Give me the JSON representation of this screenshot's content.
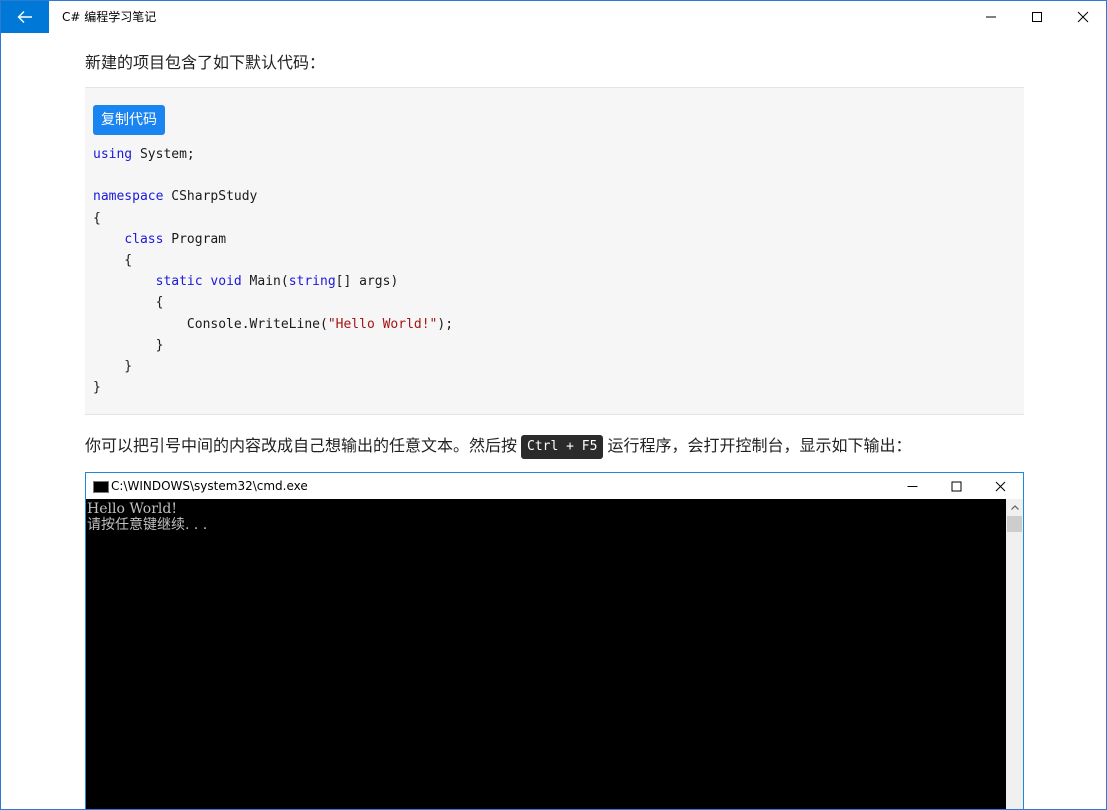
{
  "app": {
    "title": "C# 编程学习笔记"
  },
  "article": {
    "intro": "新建的项目包含了如下默认代码：",
    "copy_button": "复制代码",
    "code": {
      "l1_kw": "using",
      "l1_rest": " System;",
      "l3_kw": "namespace",
      "l3_rest": " CSharpStudy",
      "l4": "{",
      "l5_indent": "    ",
      "l5_kw": "class",
      "l5_rest": " Program",
      "l6": "    {",
      "l7_indent": "        ",
      "l7_kw1": "static",
      "l7_kw2": "void",
      "l7_mid": " Main(",
      "l7_kw3": "string",
      "l7_rest": "[] args)",
      "l8": "        {",
      "l9_pre": "            Console.WriteLine(",
      "l9_str": "\"Hello World!\"",
      "l9_post": ");",
      "l10": "        }",
      "l11": "    }",
      "l12": "}"
    },
    "para_before": "你可以把引号中间的内容改成自己想输出的任意文本。然后按",
    "shortcut": "Ctrl + F5",
    "para_after": "运行程序，会打开控制台，显示如下输出："
  },
  "console": {
    "title": "C:\\WINDOWS\\system32\\cmd.exe",
    "lines": [
      "Hello World!",
      "请按任意键继续. . ."
    ]
  },
  "colors": {
    "accent": "#0078d7",
    "keyword": "#1a1adb",
    "string": "#a31515",
    "copy_button": "#1a85f0"
  }
}
